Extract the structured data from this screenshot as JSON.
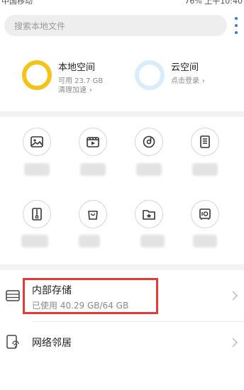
{
  "status_bar": {
    "left_text": "中国移动",
    "right_text": "76%  上午10:40"
  },
  "search": {
    "placeholder": "搜索本地文件"
  },
  "storage": {
    "local": {
      "title": "本地空间",
      "available": "可用 23.7 GB",
      "action": "清理加速"
    },
    "cloud": {
      "title": "云空间",
      "action": "点击登录"
    }
  },
  "categories": [
    {
      "icon": "image-icon"
    },
    {
      "icon": "video-icon"
    },
    {
      "icon": "music-icon"
    },
    {
      "icon": "document-icon"
    },
    {
      "icon": "zip-icon"
    },
    {
      "icon": "bag-icon"
    },
    {
      "icon": "star-folder-icon"
    },
    {
      "icon": "safe-icon"
    }
  ],
  "locations": {
    "internal": {
      "title": "内部存储",
      "usage": "已使用 40.29 GB/64 GB"
    },
    "network": {
      "title": "网络邻居"
    }
  },
  "colors": {
    "accent": "#2b7de9",
    "local_ring": "#f5c218",
    "cloud_ring": "#d9ecfb",
    "highlight": "#e23b3b"
  }
}
